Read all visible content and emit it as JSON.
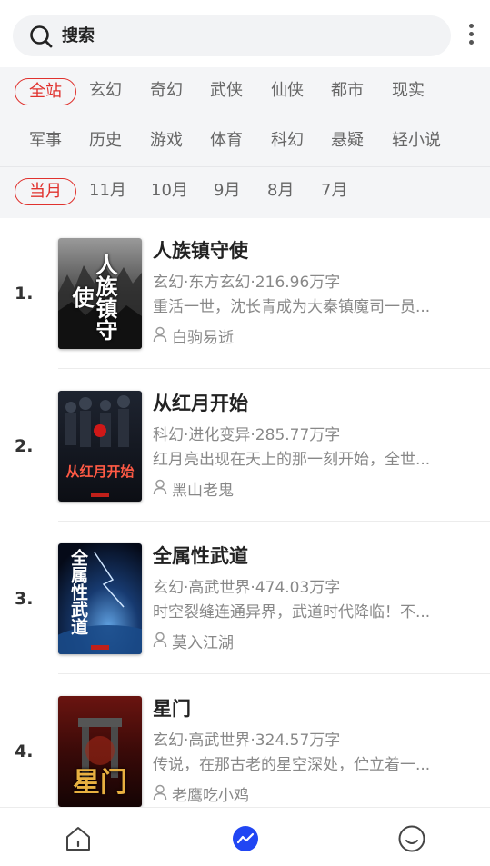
{
  "search": {
    "label": "搜索"
  },
  "categories": [
    "全站",
    "玄幻",
    "奇幻",
    "武侠",
    "仙侠",
    "都市",
    "现实",
    "军事",
    "历史",
    "游戏",
    "体育",
    "科幻",
    "悬疑",
    "轻小说"
  ],
  "active_category": "全站",
  "months": [
    "当月",
    "11月",
    "10月",
    "9月",
    "8月",
    "7月"
  ],
  "active_month": "当月",
  "books": [
    {
      "rank": "1.",
      "title": "人族镇守使",
      "meta": "玄幻·东方玄幻·216.96万字",
      "desc": "重活一世，沈长青成为大秦镇魔司一员...",
      "author": "白驹易逝",
      "cover_text": "人族镇守使"
    },
    {
      "rank": "2.",
      "title": "从红月开始",
      "meta": "科幻·进化变异·285.77万字",
      "desc": "红月亮出现在天上的那一刻开始，全世...",
      "author": "黑山老鬼",
      "cover_text": "从红月开始"
    },
    {
      "rank": "3.",
      "title": "全属性武道",
      "meta": "玄幻·高武世界·474.03万字",
      "desc": "时空裂缝连通异界，武道时代降临！不...",
      "author": "莫入江湖",
      "cover_text": "全属性武道"
    },
    {
      "rank": "4.",
      "title": "星门",
      "meta": "玄幻·高武世界·324.57万字",
      "desc": "传说，在那古老的星空深处，伫立着一...",
      "author": "老鹰吃小鸡",
      "cover_text": "星门"
    }
  ],
  "colors": {
    "accent": "#e0322e",
    "nav_active": "#2146f3",
    "filter_bg": "#f4f5f7"
  }
}
